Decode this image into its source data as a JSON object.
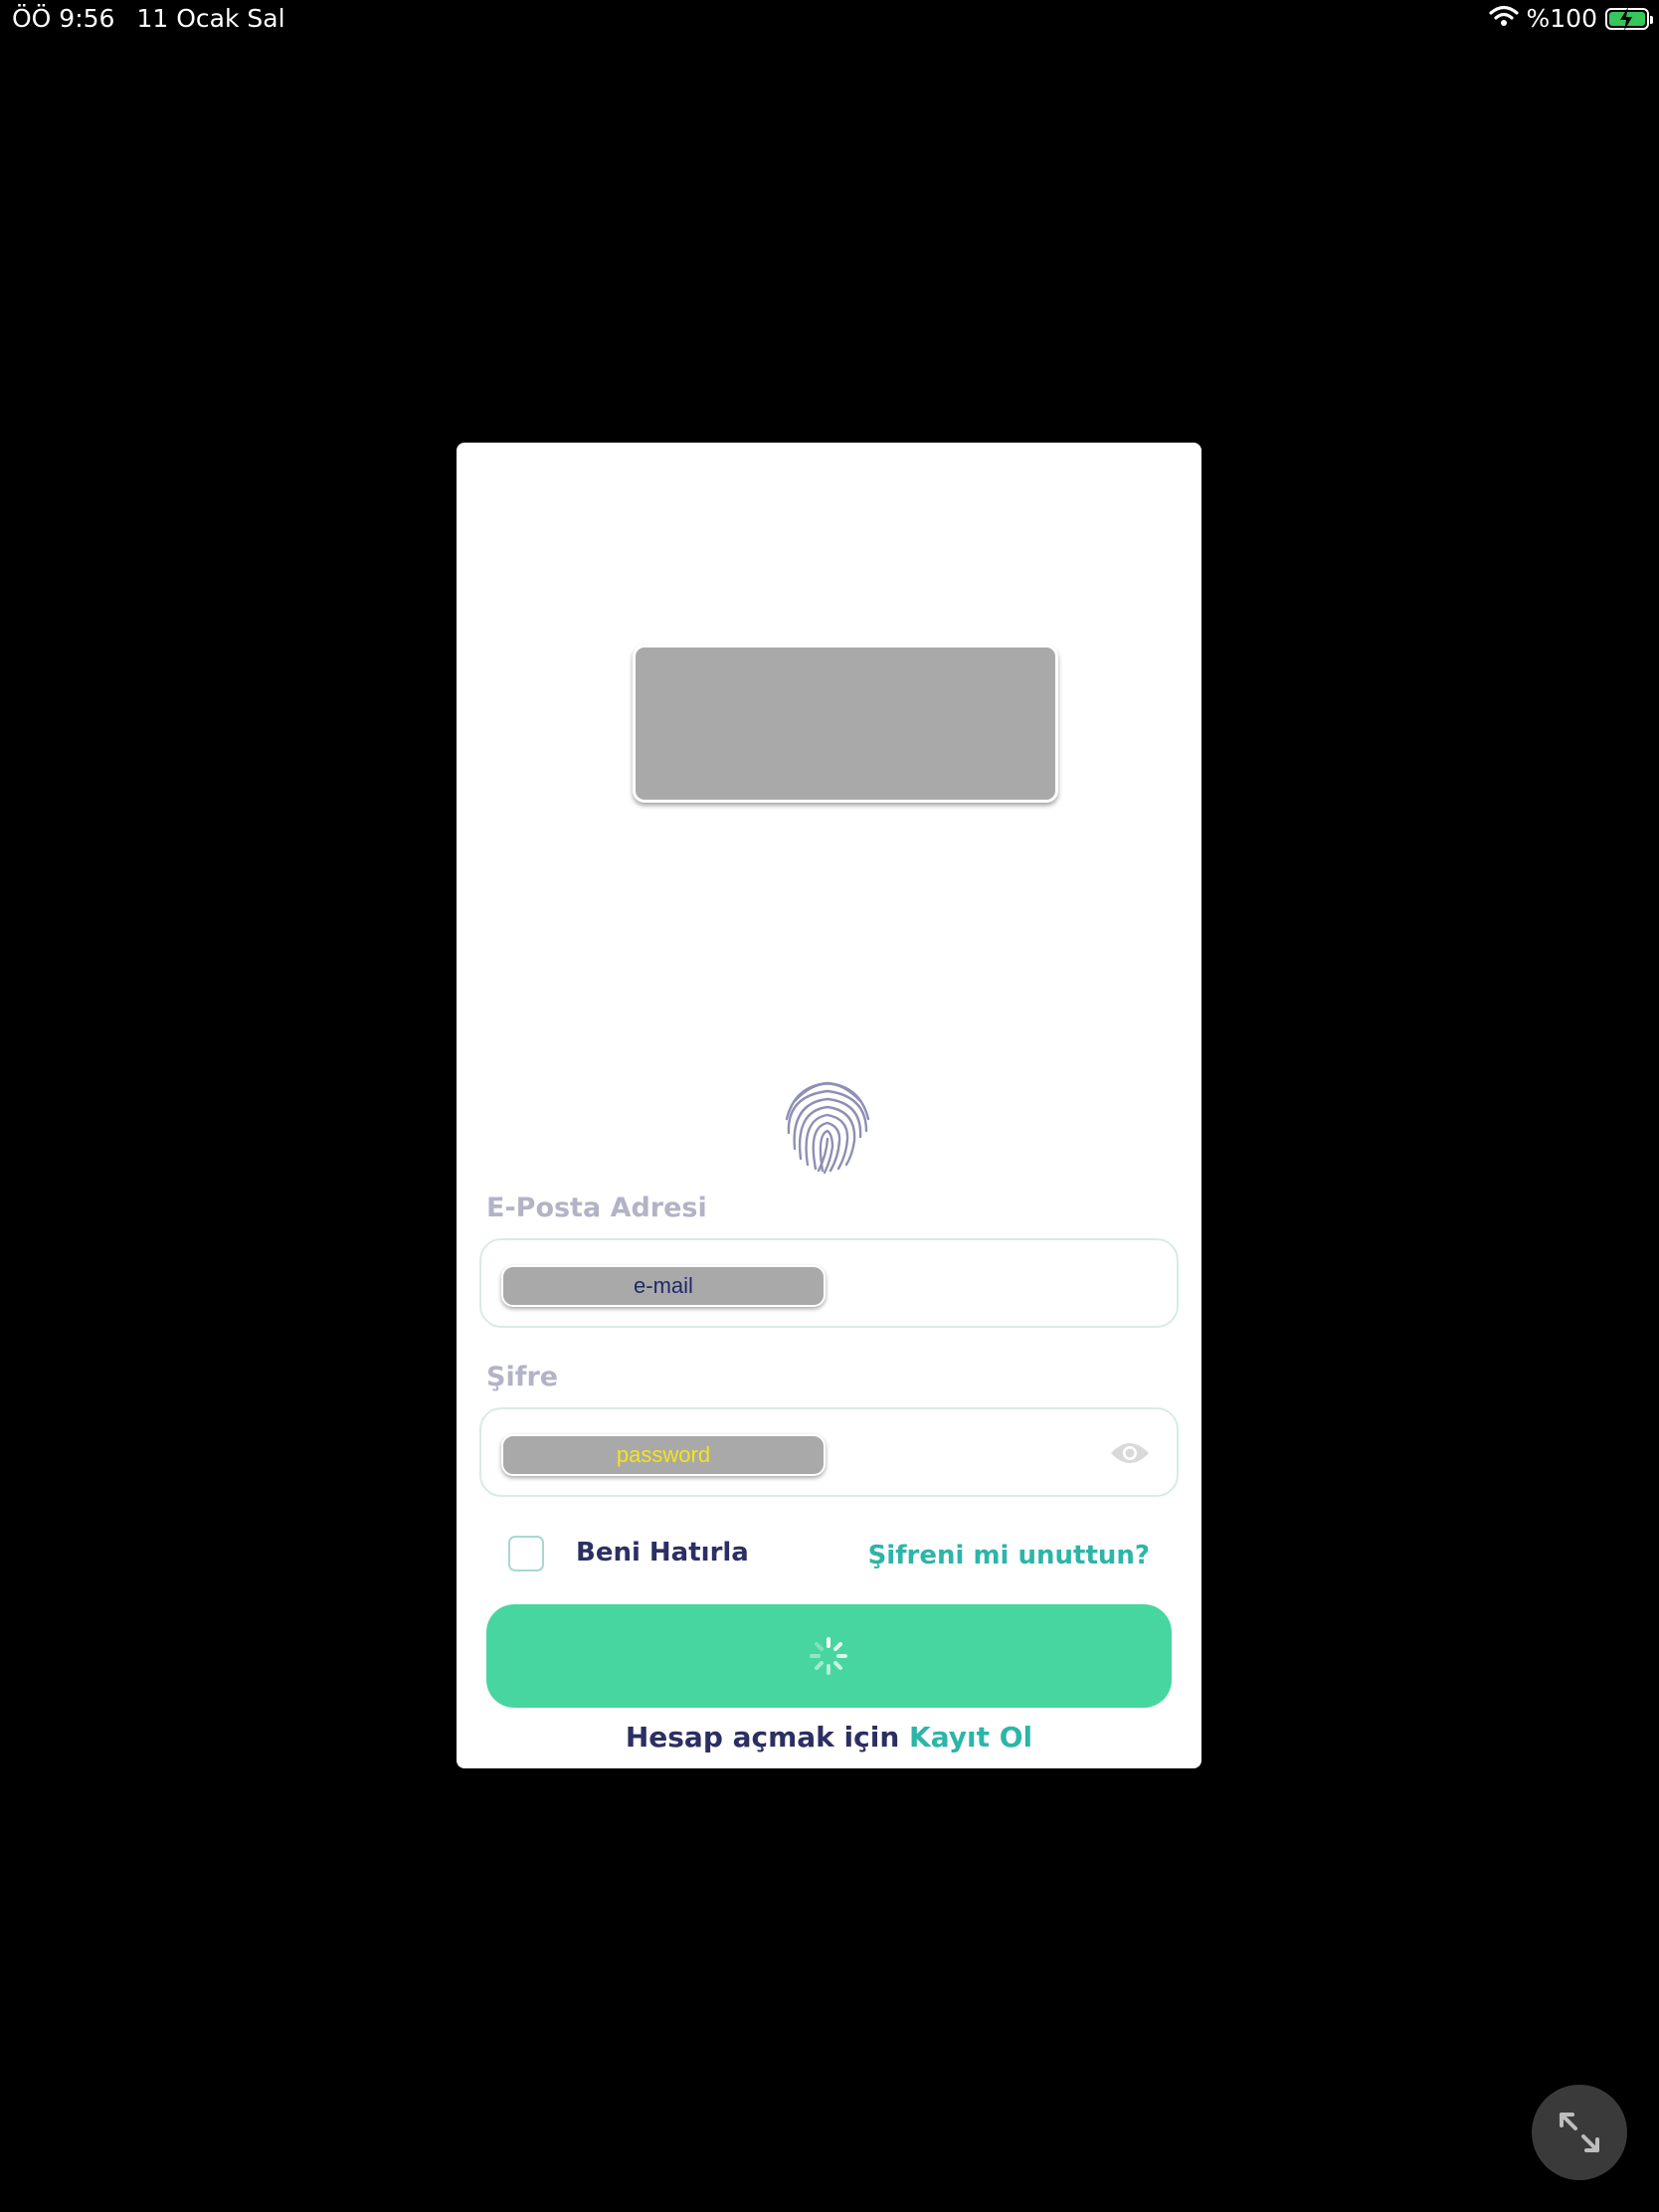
{
  "status_bar": {
    "time": "ÖÖ 9:56",
    "date": "11 Ocak Sal",
    "battery_text": "%100",
    "battery_level": 1.0
  },
  "login": {
    "email_label": "E-Posta Adresi",
    "email_value": "e-mail",
    "password_label": "Şifre",
    "password_value": "password",
    "remember_label": "Beni Hatırla",
    "remember_checked": false,
    "forgot_link": "Şifreni mi unuttun?",
    "signup_prompt": "Hesap açmak için",
    "signup_link": "Kayıt Ol",
    "login_loading": true
  },
  "colors": {
    "background": "#000000",
    "card": "#ffffff",
    "accent": "#48d6a0",
    "link": "#2cb5a8",
    "text_dark": "#2c2f63",
    "label_muted": "#b3b3c7"
  },
  "icons": [
    "wifi-icon",
    "battery-icon",
    "fingerprint-icon",
    "eye-icon",
    "spinner-icon",
    "expand-icon"
  ]
}
